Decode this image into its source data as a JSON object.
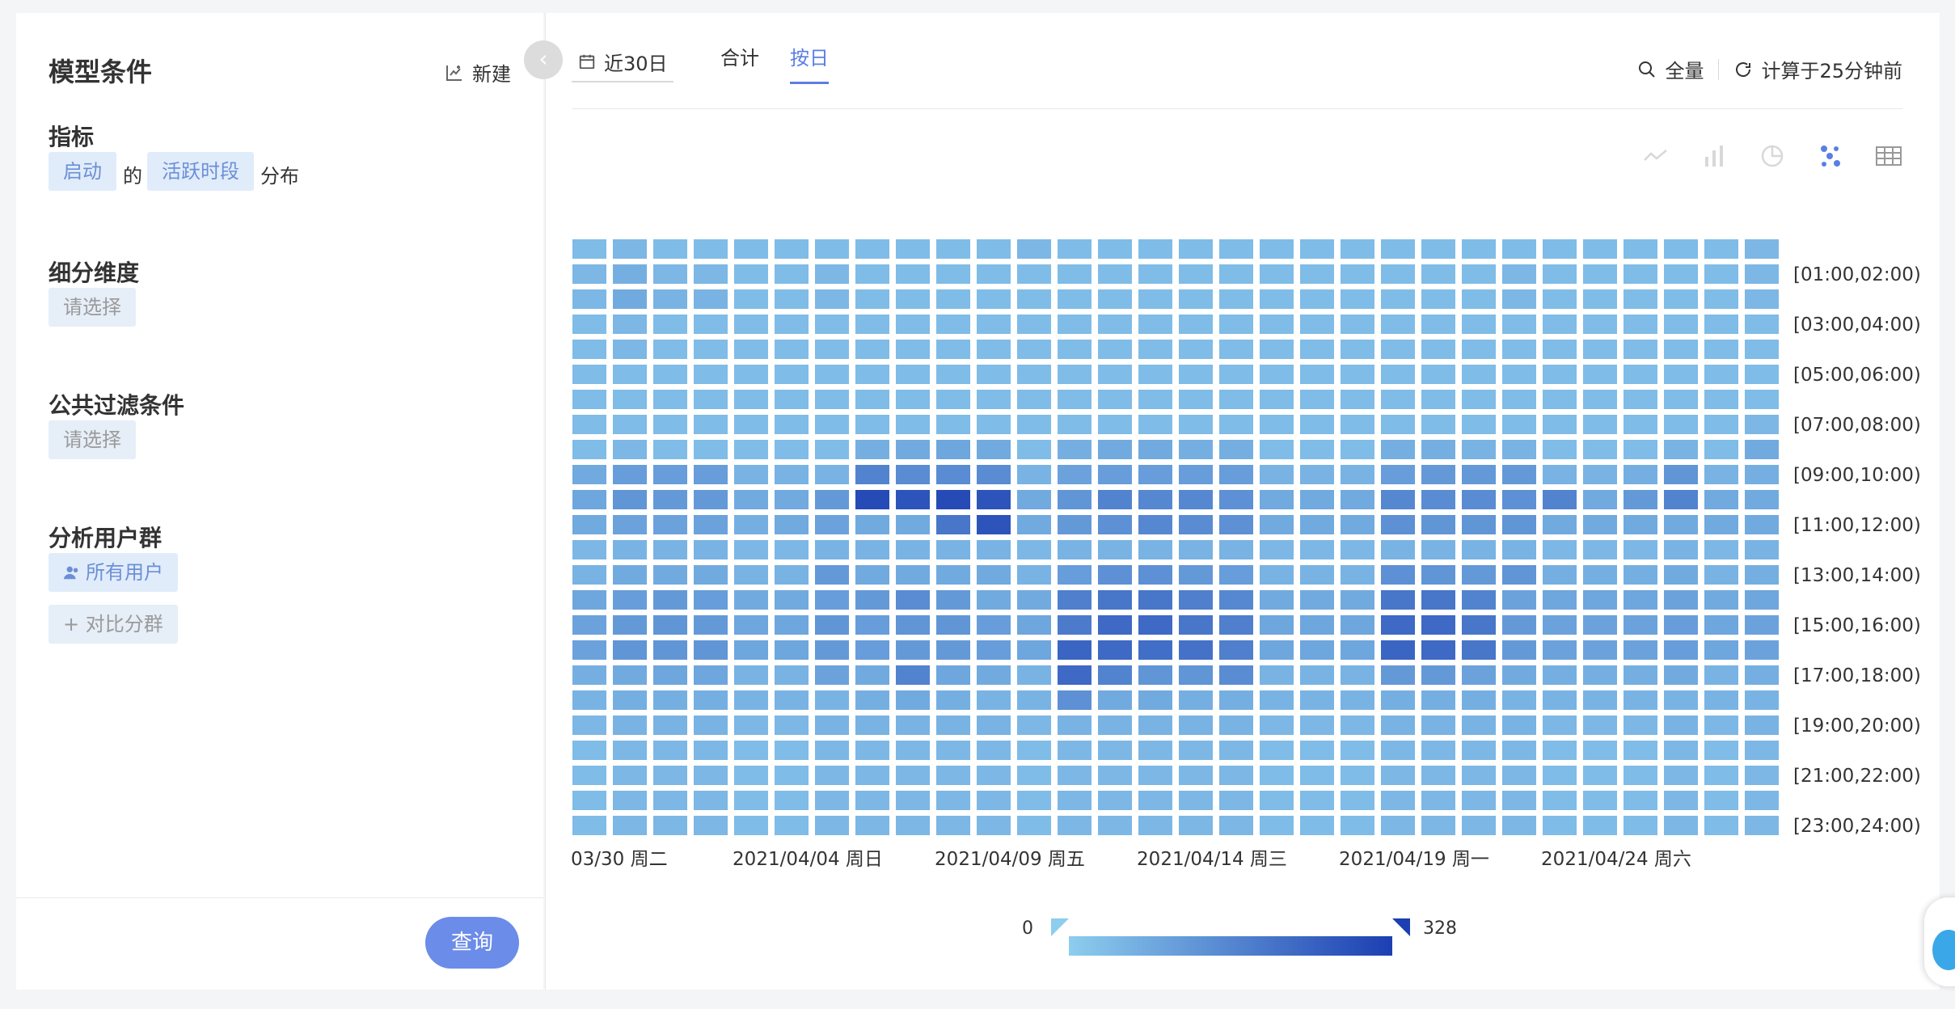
{
  "left": {
    "title": "模型条件",
    "new_label": "新建",
    "metric": {
      "heading": "指标",
      "event": "启动",
      "of": "的",
      "property": "活跃时段",
      "suffix": "分布"
    },
    "breakdown": {
      "heading": "细分维度",
      "placeholder": "请选择"
    },
    "filter": {
      "heading": "公共过滤条件",
      "placeholder": "请选择"
    },
    "segment": {
      "heading": "分析用户群",
      "all_users": "所有用户",
      "compare": "+ 对比分群"
    },
    "query_label": "查询"
  },
  "toolbar": {
    "date_range": "近30日",
    "tabs": [
      "合计",
      "按日"
    ],
    "active_tab": "按日",
    "scope_label": "全量",
    "computed_label": "计算于25分钟前"
  },
  "chart_icons": [
    "line-chart-icon",
    "bar-chart-icon",
    "pie-chart-icon",
    "scatter-chart-icon",
    "table-icon"
  ],
  "chart_data": {
    "type": "heatmap",
    "x_tick_labels": [
      "03/30 周二",
      "2021/04/04 周日",
      "2021/04/09 周五",
      "2021/04/14 周三",
      "2021/04/19 周一",
      "2021/04/24 周六"
    ],
    "x_tick_days": [
      0,
      5,
      10,
      15,
      20,
      25
    ],
    "y_tick_labels": [
      "[01:00,02:00)",
      "[03:00,04:00)",
      "[05:00,06:00)",
      "[07:00,08:00)",
      "[09:00,10:00)",
      "[11:00,12:00)",
      "[13:00,14:00)",
      "[15:00,16:00)",
      "[17:00,18:00)",
      "[19:00,20:00)",
      "[21:00,22:00)",
      "[23:00,24:00)"
    ],
    "y_tick_rows": [
      1,
      3,
      5,
      7,
      9,
      11,
      13,
      15,
      17,
      19,
      21,
      23
    ],
    "legend_min": "0",
    "legend_max": "328",
    "vmin": 0,
    "vmax": 328,
    "color_low": "#8dcdee",
    "color_high": "#1c3fb2",
    "rows": 24,
    "cols": 30,
    "values": [
      [
        40,
        50,
        40,
        40,
        40,
        40,
        40,
        40,
        40,
        40,
        40,
        50,
        40,
        40,
        40,
        40,
        40,
        40,
        40,
        40,
        40,
        40,
        40,
        40,
        40,
        40,
        40,
        40,
        40,
        50
      ],
      [
        50,
        70,
        50,
        50,
        40,
        40,
        50,
        40,
        40,
        40,
        40,
        40,
        40,
        40,
        40,
        40,
        40,
        40,
        40,
        40,
        40,
        40,
        40,
        50,
        40,
        40,
        40,
        40,
        40,
        50
      ],
      [
        50,
        80,
        60,
        60,
        40,
        40,
        50,
        40,
        40,
        40,
        40,
        40,
        40,
        40,
        40,
        40,
        40,
        40,
        40,
        40,
        40,
        40,
        40,
        50,
        40,
        40,
        40,
        40,
        40,
        50
      ],
      [
        40,
        50,
        40,
        40,
        40,
        40,
        40,
        40,
        40,
        40,
        40,
        40,
        40,
        40,
        40,
        40,
        40,
        40,
        40,
        40,
        40,
        40,
        40,
        40,
        40,
        40,
        40,
        40,
        40,
        40
      ],
      [
        40,
        50,
        40,
        40,
        40,
        40,
        40,
        40,
        40,
        40,
        40,
        40,
        40,
        40,
        40,
        40,
        40,
        40,
        40,
        40,
        40,
        40,
        40,
        40,
        40,
        40,
        40,
        40,
        40,
        40
      ],
      [
        40,
        40,
        40,
        40,
        40,
        40,
        40,
        40,
        40,
        40,
        40,
        40,
        40,
        40,
        40,
        40,
        40,
        40,
        40,
        40,
        40,
        40,
        40,
        40,
        40,
        40,
        40,
        40,
        40,
        40
      ],
      [
        40,
        40,
        40,
        40,
        40,
        40,
        40,
        40,
        40,
        40,
        40,
        40,
        40,
        40,
        40,
        40,
        40,
        40,
        40,
        40,
        40,
        40,
        40,
        40,
        40,
        40,
        40,
        40,
        40,
        40
      ],
      [
        40,
        40,
        40,
        40,
        40,
        40,
        40,
        40,
        40,
        40,
        40,
        40,
        40,
        40,
        40,
        40,
        40,
        40,
        40,
        40,
        40,
        40,
        40,
        40,
        40,
        40,
        40,
        40,
        40,
        50
      ],
      [
        40,
        50,
        40,
        40,
        40,
        40,
        40,
        70,
        80,
        90,
        80,
        40,
        70,
        80,
        80,
        70,
        70,
        40,
        40,
        40,
        70,
        70,
        60,
        60,
        40,
        40,
        40,
        60,
        40,
        80
      ],
      [
        80,
        110,
        110,
        110,
        60,
        60,
        60,
        170,
        150,
        150,
        150,
        60,
        100,
        110,
        110,
        110,
        110,
        60,
        60,
        60,
        110,
        120,
        120,
        120,
        60,
        60,
        70,
        130,
        60,
        70
      ],
      [
        90,
        130,
        120,
        120,
        80,
        80,
        120,
        300,
        280,
        300,
        280,
        80,
        130,
        170,
        160,
        160,
        140,
        80,
        80,
        80,
        160,
        150,
        150,
        140,
        170,
        80,
        120,
        170,
        80,
        80
      ],
      [
        80,
        100,
        100,
        100,
        70,
        80,
        100,
        80,
        80,
        200,
        280,
        80,
        120,
        140,
        160,
        150,
        140,
        80,
        80,
        80,
        140,
        130,
        130,
        130,
        80,
        80,
        80,
        80,
        80,
        80
      ],
      [
        50,
        60,
        60,
        60,
        50,
        50,
        60,
        60,
        60,
        60,
        60,
        50,
        60,
        60,
        60,
        60,
        60,
        50,
        50,
        50,
        60,
        60,
        60,
        60,
        50,
        50,
        50,
        60,
        50,
        60
      ],
      [
        60,
        80,
        80,
        80,
        60,
        60,
        120,
        80,
        80,
        80,
        80,
        60,
        110,
        140,
        140,
        120,
        110,
        60,
        60,
        60,
        140,
        130,
        120,
        130,
        70,
        70,
        70,
        80,
        60,
        70
      ],
      [
        90,
        110,
        120,
        110,
        80,
        80,
        110,
        120,
        150,
        120,
        80,
        80,
        180,
        200,
        200,
        180,
        160,
        80,
        80,
        80,
        200,
        200,
        170,
        100,
        90,
        90,
        90,
        100,
        80,
        90
      ],
      [
        100,
        120,
        130,
        120,
        90,
        90,
        130,
        110,
        130,
        130,
        110,
        90,
        190,
        230,
        230,
        200,
        180,
        90,
        90,
        90,
        230,
        230,
        200,
        120,
        100,
        100,
        100,
        110,
        90,
        100
      ],
      [
        100,
        130,
        130,
        130,
        90,
        90,
        120,
        110,
        120,
        120,
        110,
        90,
        240,
        230,
        220,
        210,
        180,
        90,
        90,
        90,
        240,
        230,
        200,
        120,
        100,
        100,
        100,
        110,
        90,
        100
      ],
      [
        70,
        80,
        90,
        90,
        60,
        60,
        100,
        80,
        170,
        90,
        80,
        60,
        230,
        170,
        130,
        130,
        150,
        60,
        60,
        60,
        120,
        120,
        100,
        80,
        70,
        70,
        70,
        80,
        60,
        70
      ],
      [
        60,
        70,
        70,
        70,
        60,
        60,
        60,
        70,
        80,
        70,
        60,
        60,
        140,
        80,
        80,
        70,
        70,
        60,
        60,
        60,
        70,
        70,
        70,
        60,
        60,
        60,
        60,
        60,
        60,
        60
      ],
      [
        50,
        60,
        60,
        60,
        50,
        50,
        60,
        60,
        60,
        60,
        60,
        50,
        60,
        60,
        60,
        60,
        60,
        50,
        50,
        50,
        60,
        60,
        60,
        60,
        50,
        50,
        50,
        60,
        50,
        60
      ],
      [
        40,
        50,
        50,
        50,
        40,
        40,
        50,
        50,
        50,
        50,
        50,
        40,
        50,
        50,
        50,
        50,
        50,
        40,
        40,
        40,
        50,
        50,
        50,
        50,
        40,
        40,
        40,
        50,
        40,
        50
      ],
      [
        40,
        50,
        50,
        50,
        40,
        40,
        50,
        50,
        50,
        50,
        50,
        40,
        50,
        50,
        50,
        50,
        50,
        40,
        40,
        40,
        50,
        50,
        50,
        50,
        40,
        40,
        40,
        50,
        40,
        50
      ],
      [
        40,
        50,
        50,
        50,
        40,
        40,
        50,
        50,
        50,
        50,
        50,
        40,
        50,
        50,
        50,
        50,
        50,
        40,
        40,
        40,
        50,
        50,
        50,
        50,
        40,
        40,
        40,
        50,
        40,
        50
      ],
      [
        40,
        50,
        50,
        50,
        40,
        40,
        50,
        50,
        50,
        50,
        50,
        40,
        50,
        50,
        50,
        50,
        50,
        40,
        40,
        40,
        50,
        50,
        50,
        50,
        40,
        40,
        40,
        50,
        40,
        50
      ]
    ]
  }
}
